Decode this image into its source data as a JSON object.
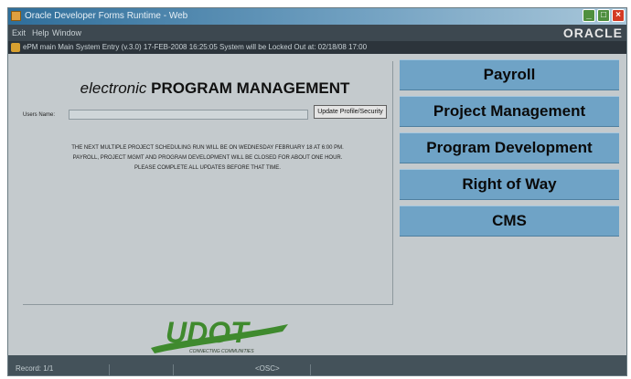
{
  "window": {
    "title": "Oracle Developer Forms Runtime - Web"
  },
  "menu": {
    "items": [
      "Exit",
      "Help",
      "Window"
    ]
  },
  "brand": {
    "oracle": "ORACLE",
    "logo_text": "UDOT",
    "logo_tagline": "CONNECTING COMMUNITIES"
  },
  "infobar": {
    "text": "ePM main Main System Entry (v.3.0) 17-FEB-2008 16:25:05 System will be Locked Out at: 02/18/08 17:00"
  },
  "main": {
    "heading_italic": "electronic",
    "heading_bold": "PROGRAM MANAGEMENT",
    "users_name_label": "Users Name:",
    "users_name_value": "",
    "update_button": "Update Profile/Security",
    "notice_lines": [
      "THE NEXT MULTIPLE PROJECT SCHEDULING RUN WILL BE ON WEDNESDAY FEBRUARY 18 AT 6:00 PM.",
      "PAYROLL, PROJECT MGMT AND PROGRAM DEVELOPMENT WILL BE CLOSED FOR ABOUT ONE HOUR.",
      "PLEASE COMPLETE ALL UPDATES BEFORE THAT TIME."
    ]
  },
  "apps": [
    "Payroll",
    "Project Management",
    "Program Development",
    "Right of Way",
    "CMS"
  ],
  "status": {
    "record": "Record: 1/1",
    "osc": "<OSC>"
  },
  "colors": {
    "app_button": "#6fa3c6",
    "background": "#c4cacd",
    "logo_green": "#3f8a2e"
  }
}
